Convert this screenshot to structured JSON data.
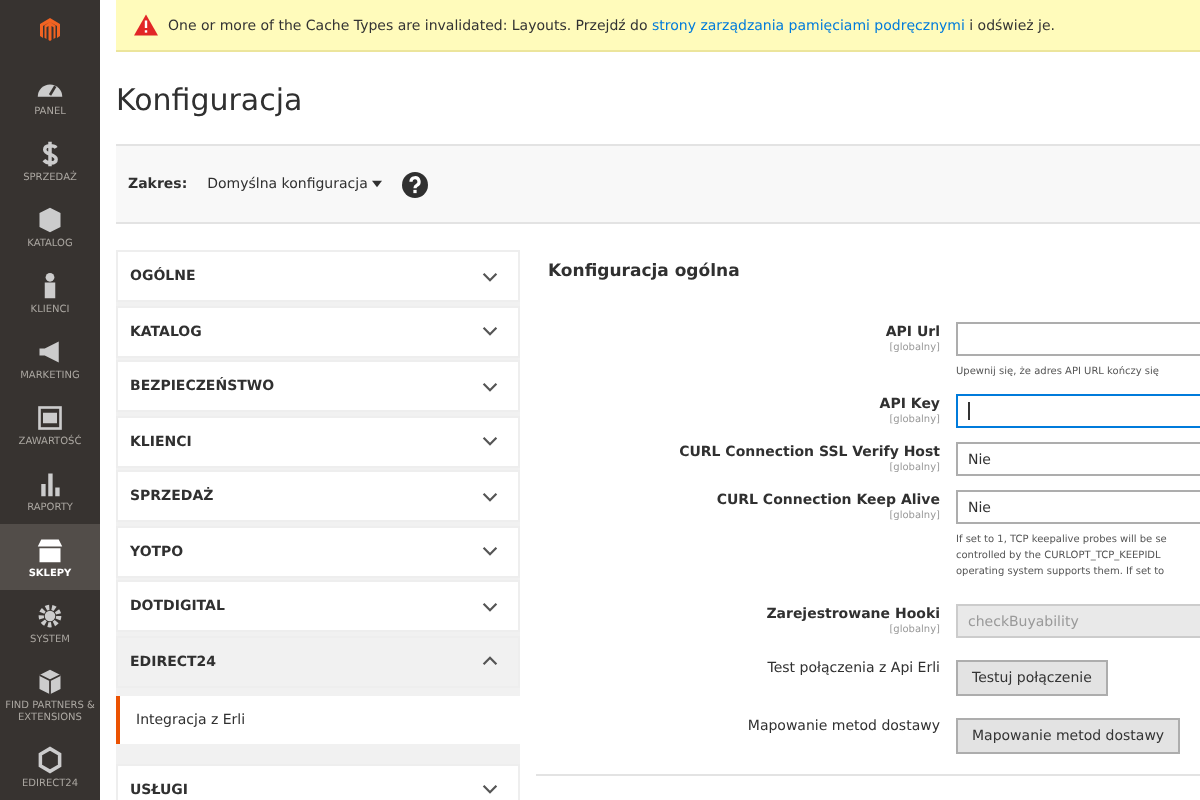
{
  "sidebar": {
    "items": [
      {
        "label": "PANEL",
        "selected": false
      },
      {
        "label": "SPRZEDAŻ",
        "selected": false
      },
      {
        "label": "KATALOG",
        "selected": false
      },
      {
        "label": "KLIENCI",
        "selected": false
      },
      {
        "label": "MARKETING",
        "selected": false
      },
      {
        "label": "ZAWARTOŚĆ",
        "selected": false
      },
      {
        "label": "RAPORTY",
        "selected": false
      },
      {
        "label": "SKLEPY",
        "selected": true
      },
      {
        "label": "SYSTEM",
        "selected": false
      },
      {
        "label": "FIND PARTNERS & EXTENSIONS",
        "selected": false
      },
      {
        "label": "EDIRECT24",
        "selected": false
      }
    ]
  },
  "notice": {
    "before": "One or more of the Cache Types are invalidated: Layouts. Przejdź do ",
    "link": "strony zarządzania pamięciami podręcznymi",
    "after": " i odśwież je."
  },
  "page_title": "Konfiguracja",
  "scope": {
    "label": "Zakres:",
    "value": "Domyślna konfiguracja"
  },
  "nav": [
    {
      "label": "OGÓLNE",
      "expanded": false
    },
    {
      "label": "KATALOG",
      "expanded": false
    },
    {
      "label": "BEZPIECZEŃSTWO",
      "expanded": false
    },
    {
      "label": "KLIENCI",
      "expanded": false
    },
    {
      "label": "SPRZEDAŻ",
      "expanded": false
    },
    {
      "label": "YOTPO",
      "expanded": false
    },
    {
      "label": "DOTDIGITAL",
      "expanded": false
    },
    {
      "label": "EDIRECT24",
      "expanded": true,
      "children": [
        {
          "label": "Integracja z Erli",
          "selected": true
        }
      ]
    },
    {
      "label": "USŁUGI",
      "expanded": false
    }
  ],
  "section_title": "Konfiguracja ogólna",
  "fields": [
    {
      "kind": "input",
      "label": "API Url",
      "scope": "[globalny]",
      "focused": false,
      "hint": [
        "Upewnij się, że adres API URL kończy się"
      ]
    },
    {
      "kind": "input",
      "label": "API Key",
      "scope": "[globalny]",
      "focused": true
    },
    {
      "kind": "select",
      "label": "CURL Connection SSL Verify Host",
      "scope": "[globalny]",
      "value": "Nie"
    },
    {
      "kind": "select",
      "label": "CURL Connection Keep Alive",
      "scope": "[globalny]",
      "value": "Nie",
      "hint": [
        "If set to 1, TCP keepalive probes will be se",
        "controlled by the CURLOPT_TCP_KEEPIDL",
        "operating system supports them. If set to"
      ]
    },
    {
      "kind": "disabled",
      "label": "Zarejestrowane Hooki",
      "scope": "[globalny]",
      "value": "checkBuyability"
    },
    {
      "kind": "button",
      "label": "Test połączenia z Api Erli",
      "value": "Testuj połączenie"
    },
    {
      "kind": "button",
      "label": "Mapowanie metod dostawy",
      "value": "Mapowanie metod dostawy"
    }
  ]
}
